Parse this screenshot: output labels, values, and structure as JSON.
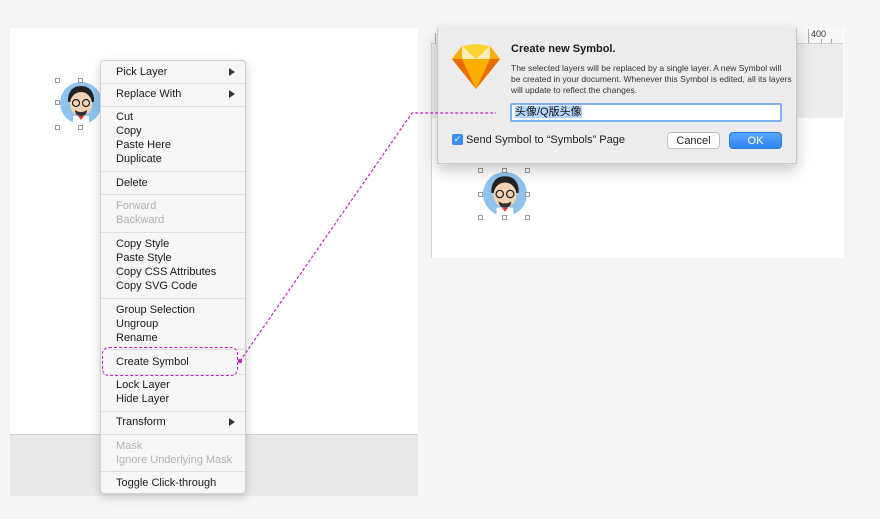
{
  "context_menu": {
    "items": [
      {
        "label": "Pick Layer",
        "disabled": false,
        "submenu": true
      },
      {
        "label": "Replace With",
        "disabled": false,
        "submenu": true
      },
      {
        "label": "Cut",
        "disabled": false
      },
      {
        "label": "Copy",
        "disabled": false
      },
      {
        "label": "Paste Here",
        "disabled": false
      },
      {
        "label": "Duplicate",
        "disabled": false
      },
      {
        "label": "Delete",
        "disabled": false
      },
      {
        "label": "Forward",
        "disabled": true
      },
      {
        "label": "Backward",
        "disabled": true
      },
      {
        "label": "Copy Style",
        "disabled": false
      },
      {
        "label": "Paste Style",
        "disabled": false
      },
      {
        "label": "Copy CSS Attributes",
        "disabled": false
      },
      {
        "label": "Copy SVG Code",
        "disabled": false
      },
      {
        "label": "Group Selection",
        "disabled": false
      },
      {
        "label": "Ungroup",
        "disabled": false
      },
      {
        "label": "Rename",
        "disabled": false
      },
      {
        "label": "Create Symbol",
        "disabled": false,
        "highlighted": true
      },
      {
        "label": "Lock Layer",
        "disabled": false
      },
      {
        "label": "Hide Layer",
        "disabled": false
      },
      {
        "label": "Transform",
        "disabled": false,
        "submenu": true
      },
      {
        "label": "Mask",
        "disabled": true
      },
      {
        "label": "Ignore Underlying Mask",
        "disabled": true
      },
      {
        "label": "Toggle Click-through",
        "disabled": false
      }
    ]
  },
  "ruler": {
    "label": "400"
  },
  "dialog": {
    "title": "Create new Symbol.",
    "description": "The selected layers will be replaced by a single layer. A new Symbol will be created in your document. Whenever this Symbol is edited, all its layers will update to reflect the changes.",
    "input_value": "头像/Q版头像",
    "checkbox_checked": true,
    "checkbox_label": "Send Symbol to “Symbols” Page",
    "cancel_label": "Cancel",
    "ok_label": "OK"
  },
  "colors": {
    "accent": "#3b8ff0",
    "highlight_dash": "#c31fc3",
    "avatar_bg": "#8ec3ee"
  }
}
